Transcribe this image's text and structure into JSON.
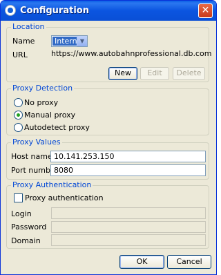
{
  "window": {
    "title": "Configuration",
    "close_glyph": "✕"
  },
  "location": {
    "title": "Location",
    "name_label": "Name",
    "name_value": "Internet",
    "url_label": "URL",
    "url_value": "https://www.autobahnprofessional.db.com",
    "buttons": {
      "new": "New",
      "edit": "Edit",
      "delete": "Delete"
    }
  },
  "proxy_detection": {
    "title": "Proxy Detection",
    "options": [
      {
        "label": "No proxy",
        "checked": false
      },
      {
        "label": "Manual proxy",
        "checked": true
      },
      {
        "label": "Autodetect proxy",
        "checked": false
      }
    ]
  },
  "proxy_values": {
    "title": "Proxy Values",
    "host_label": "Host name",
    "host_value": "10.141.253.150",
    "port_label": "Port number",
    "port_value": "8080"
  },
  "proxy_auth": {
    "title": "Proxy Authentication",
    "checkbox_label": "Proxy authentication",
    "checked": false,
    "login_label": "Login",
    "login_value": "",
    "password_label": "Password",
    "password_value": "",
    "domain_label": "Domain",
    "domain_value": ""
  },
  "footer": {
    "ok": "OK",
    "cancel": "Cancel"
  },
  "colors": {
    "accent": "#0046d5",
    "titlebar": "#0a5fe6",
    "radio_dot": "#21a121"
  }
}
